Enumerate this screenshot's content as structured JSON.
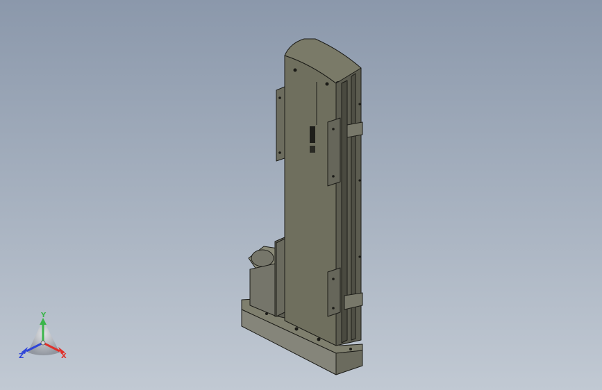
{
  "view": {
    "background_top": "#8b98ab",
    "background_bottom": "#c1c9d3"
  },
  "model": {
    "body_color": "#6f6f5e",
    "edge_color": "#1c1c18",
    "rail_color": "#5c5c50"
  },
  "triad": {
    "x_label": "X",
    "y_label": "Y",
    "z_label": "Z",
    "x_color": "#e0302a",
    "y_color": "#3bb54a",
    "z_color": "#2f45d8"
  }
}
